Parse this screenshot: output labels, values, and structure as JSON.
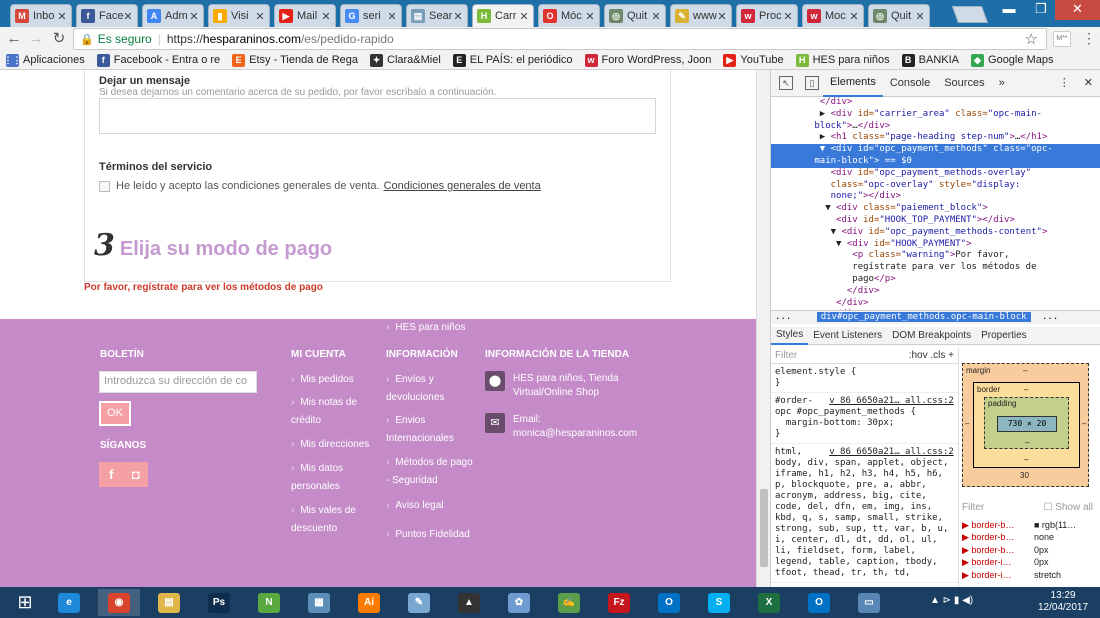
{
  "browser": {
    "tabs": [
      {
        "title": "Inbo",
        "icon": "gmail-icon",
        "color": "#d44638",
        "glyph": "M"
      },
      {
        "title": "Face",
        "icon": "facebook-icon",
        "color": "#3b5998",
        "glyph": "f"
      },
      {
        "title": "Adm",
        "icon": "adwords-icon",
        "color": "#4285f4",
        "glyph": "A"
      },
      {
        "title": "Visi",
        "icon": "analytics-icon",
        "color": "#f9ab00",
        "glyph": "▮"
      },
      {
        "title": "Mail",
        "icon": "youtube-icon",
        "color": "#e62117",
        "glyph": "▶"
      },
      {
        "title": "seri",
        "icon": "google-icon",
        "color": "#4a8af4",
        "glyph": "G"
      },
      {
        "title": "Sear",
        "icon": "search-console-icon",
        "color": "#7a9db8",
        "glyph": "▤"
      },
      {
        "title": "Carr",
        "icon": "hes-icon",
        "color": "#7cba3c",
        "glyph": "H"
      },
      {
        "title": "Móc",
        "icon": "opera-icon",
        "color": "#e2332d",
        "glyph": "O"
      },
      {
        "title": "Quit",
        "icon": "globe-icon",
        "color": "#6f8a6a",
        "glyph": "◎"
      },
      {
        "title": "www",
        "icon": "pencil-icon",
        "color": "#d9b233",
        "glyph": "✎"
      },
      {
        "title": "Proc",
        "icon": "wallapop-icon",
        "color": "#d0283a",
        "glyph": "w"
      },
      {
        "title": "Moc",
        "icon": "wallapop-icon",
        "color": "#d0283a",
        "glyph": "w"
      },
      {
        "title": "Quit",
        "icon": "globe-icon",
        "color": "#6f8a6a",
        "glyph": "◎"
      }
    ],
    "close_glyph": "✕",
    "secure_label": "Es seguro",
    "url_scheme": "https://",
    "url_host": "hesparaninos.com",
    "url_path": "/es/pedido-rapido",
    "extension_label": "M**"
  },
  "bookmarks": [
    {
      "label": "Aplicaciones",
      "icon": "apps-icon",
      "color": "#4a74c9",
      "glyph": "⋮⋮"
    },
    {
      "label": "Facebook - Entra o re",
      "icon": "facebook-icon",
      "color": "#3b5998",
      "glyph": "f"
    },
    {
      "label": "Etsy - Tienda de Rega",
      "icon": "etsy-icon",
      "color": "#f1641e",
      "glyph": "E"
    },
    {
      "label": "Clara&Miel",
      "icon": "butterfly-icon",
      "color": "#333333",
      "glyph": "✦"
    },
    {
      "label": "EL PAÍS: el periódico",
      "icon": "elpais-icon",
      "color": "#222222",
      "glyph": "E"
    },
    {
      "label": "Foro WordPress, Joon",
      "icon": "wallapop-icon",
      "color": "#d0283a",
      "glyph": "w"
    },
    {
      "label": "YouTube",
      "icon": "youtube-icon",
      "color": "#e62117",
      "glyph": "▶"
    },
    {
      "label": "HES para niños",
      "icon": "hes-icon",
      "color": "#7cba3c",
      "glyph": "H"
    },
    {
      "label": "BANKIA",
      "icon": "bankia-icon",
      "color": "#222222",
      "glyph": "B"
    },
    {
      "label": "Google Maps",
      "icon": "maps-icon",
      "color": "#34a853",
      "glyph": "◆"
    }
  ],
  "page": {
    "message_title": "Dejar un mensaje",
    "message_hint": "Si desea dejarnos un comentario acerca de su pedido, por favor escríbalo a continuación.",
    "terms_title": "Términos del servicio",
    "terms_text": "He leído y acepto las condiciones generales de venta.",
    "terms_link": "Condiciones generales de venta",
    "step_number": "3",
    "step_title": "Elija su modo de pago",
    "warning": "Por favor, regístrate para ver los métodos de pago"
  },
  "footer": {
    "newsletter_heading": "BOLETÍN",
    "newsletter_placeholder": "Introduzca su dirección de co",
    "ok_label": "OK",
    "follow_heading": "SÍGANOS",
    "facebook_glyph": "f",
    "instagram_glyph": "◘",
    "account_heading": "MI CUENTA",
    "account_links": [
      "Mis pedidos",
      "Mis notas de crédito",
      "Mis direcciones",
      "Mis datos personales",
      "Mis vales de descuento"
    ],
    "info_heading": "INFORMACIÓN",
    "info_links": [
      "Envíos y devoluciones",
      "Envios Internacionales",
      "Métodos de pago - Seguridad",
      "Aviso legal",
      "Puntos Fidelidad",
      "HES para niños"
    ],
    "store_heading": "INFORMACIÓN DE LA TIENDA",
    "store_name": "HES para niños, Tienda Virtual/Online Shop",
    "email_label": "Email:",
    "email": "monica@hesparaninos.com"
  },
  "devtools": {
    "tabs": [
      "Elements",
      "Console",
      "Sources",
      "»"
    ],
    "dom_lines": [
      {
        "indent": 9,
        "parts": [
          [
            "tag",
            "</div>"
          ]
        ]
      },
      {
        "indent": 9,
        "parts": [
          [
            "p",
            "▶ "
          ],
          [
            "tag",
            "<div "
          ],
          [
            "an",
            "id="
          ],
          [
            "av",
            "\"carrier_area\""
          ],
          [
            "an",
            " class="
          ],
          [
            "av",
            "\"opc-main-"
          ]
        ]
      },
      {
        "indent": 8,
        "parts": [
          [
            "av",
            "block\""
          ],
          [
            "tag",
            ">"
          ],
          [
            "p",
            "…"
          ],
          [
            "tag",
            "</div>"
          ]
        ]
      },
      {
        "indent": 9,
        "parts": [
          [
            "p",
            "▶ "
          ],
          [
            "tag",
            "<h1 "
          ],
          [
            "an",
            "class="
          ],
          [
            "av",
            "\"page-heading step-num\""
          ],
          [
            "tag",
            ">"
          ],
          [
            "p",
            "…"
          ],
          [
            "tag",
            "</h1>"
          ]
        ]
      },
      {
        "indent": 9,
        "sel": true,
        "parts": [
          [
            "p",
            "▼ "
          ],
          [
            "tag",
            "<div "
          ],
          [
            "an",
            "id="
          ],
          [
            "av",
            "\"opc_payment_methods\""
          ],
          [
            "an",
            " class="
          ],
          [
            "av",
            "\"opc-"
          ]
        ]
      },
      {
        "indent": 8,
        "sel": true,
        "parts": [
          [
            "av",
            "main-block\""
          ],
          [
            "tag",
            ">"
          ],
          [
            "p",
            " == $0"
          ]
        ]
      },
      {
        "indent": 11,
        "parts": [
          [
            "tag",
            "<div "
          ],
          [
            "an",
            "id="
          ],
          [
            "av",
            "\"opc_payment_methods-overlay\""
          ]
        ]
      },
      {
        "indent": 11,
        "parts": [
          [
            "an",
            "class="
          ],
          [
            "av",
            "\"opc-overlay\""
          ],
          [
            "an",
            " style="
          ],
          [
            "av",
            "\"display:"
          ]
        ]
      },
      {
        "indent": 11,
        "parts": [
          [
            "av",
            "none;\""
          ],
          [
            "tag",
            "></div>"
          ]
        ]
      },
      {
        "indent": 10,
        "parts": [
          [
            "p",
            "▼ "
          ],
          [
            "tag",
            "<div "
          ],
          [
            "an",
            "class="
          ],
          [
            "av",
            "\"paiement_block\""
          ],
          [
            "tag",
            ">"
          ]
        ]
      },
      {
        "indent": 12,
        "parts": [
          [
            "tag",
            "<div "
          ],
          [
            "an",
            "id="
          ],
          [
            "av",
            "\"HOOK_TOP_PAYMENT\""
          ],
          [
            "tag",
            "></div>"
          ]
        ]
      },
      {
        "indent": 11,
        "parts": [
          [
            "p",
            "▼ "
          ],
          [
            "tag",
            "<div "
          ],
          [
            "an",
            "id="
          ],
          [
            "av",
            "\"opc_payment_methods-content\""
          ],
          [
            "tag",
            ">"
          ]
        ]
      },
      {
        "indent": 12,
        "parts": [
          [
            "p",
            "▼ "
          ],
          [
            "tag",
            "<div "
          ],
          [
            "an",
            "id="
          ],
          [
            "av",
            "\"HOOK_PAYMENT\""
          ],
          [
            "tag",
            ">"
          ]
        ]
      },
      {
        "indent": 15,
        "parts": [
          [
            "tag",
            "<p "
          ],
          [
            "an",
            "class="
          ],
          [
            "av",
            "\"warning\""
          ],
          [
            "tag",
            ">"
          ],
          [
            "p",
            "Por favor,"
          ]
        ]
      },
      {
        "indent": 15,
        "parts": [
          [
            "p",
            "regístrate para ver los métodos de"
          ]
        ]
      },
      {
        "indent": 15,
        "parts": [
          [
            "p",
            "pago"
          ],
          [
            "tag",
            "</p>"
          ]
        ]
      },
      {
        "indent": 14,
        "parts": [
          [
            "tag",
            "</div>"
          ]
        ]
      },
      {
        "indent": 12,
        "parts": [
          [
            "tag",
            "</div>"
          ]
        ]
      },
      {
        "indent": 11,
        "parts": [
          [
            "tag",
            "</div>"
          ]
        ]
      }
    ],
    "breadcrumb_dots": "...",
    "breadcrumb": "div#opc_payment_methods.opc-main-block",
    "breadcrumb_more": "...",
    "style_tabs": [
      "Styles",
      "Event Listeners",
      "DOM Breakpoints",
      "Properties"
    ],
    "filter_placeholder": "Filter",
    "filter_hov": ":hov  .cls  +",
    "element_style": "element.style {\n}",
    "rule1_selector": "#order-",
    "rule1_source": "v_86_6650a21… all.css:2",
    "rule1_body": "opc #opc_payment_methods {\n  margin-bottom: 30px;\n}",
    "rule2_selector": "html,",
    "rule2_source": "v_86_6650a21… all.css:2",
    "rule2_body": "body, div, span, applet, object,\niframe, h1, h2, h3, h4, h5, h6,\np, blockquote, pre, a, abbr,\nacronym, address, big, cite,\ncode, del, dfn, em, img, ins,\nkbd, q, s, samp, small, strike,\nstrong, sub, sup, tt, var, b, u,\ni, center, dl, dt, dd, ol, ul,\nli, fieldset, form, label,\nlegend, table, caption, tbody,\ntfoot, thead, tr, th, td,",
    "box_margin_label": "margin",
    "box_border_label": "border",
    "box_padding_label": "padding",
    "box_dash": "–",
    "box_content": "730 × 20",
    "box_margin_bottom": "30",
    "computed_filter": "Filter",
    "computed_show_all": "Show all",
    "computed_rows": [
      {
        "k": "▶ border-b…",
        "v": "■ rgb(11…"
      },
      {
        "k": "▶ border-b…",
        "v": "none"
      },
      {
        "k": "▶ border-b…",
        "v": "0px"
      },
      {
        "k": "▶ border-i…",
        "v": "0px"
      },
      {
        "k": "▶ border-i…",
        "v": "stretch"
      }
    ]
  },
  "taskbar": {
    "items": [
      {
        "name": "ie-taskbar-icon",
        "glyph": "e",
        "color": "#1e88d8"
      },
      {
        "name": "chrome-taskbar-icon",
        "glyph": "◉",
        "color": "#d9442f",
        "active": true
      },
      {
        "name": "file-explorer-taskbar-icon",
        "glyph": "▤",
        "color": "#e0b64a"
      },
      {
        "name": "photoshop-taskbar-icon",
        "glyph": "Ps",
        "color": "#0f2e4d"
      },
      {
        "name": "notepadpp-taskbar-icon",
        "glyph": "N",
        "color": "#59a840"
      },
      {
        "name": "calculator-taskbar-icon",
        "glyph": "▦",
        "color": "#5b8fb8"
      },
      {
        "name": "illustrator-taskbar-icon",
        "glyph": "Ai",
        "color": "#ff7c00"
      },
      {
        "name": "notepad-taskbar-icon",
        "glyph": "✎",
        "color": "#7aa7cf"
      },
      {
        "name": "inkscape-taskbar-icon",
        "glyph": "▲",
        "color": "#333333"
      },
      {
        "name": "paint-taskbar-icon",
        "glyph": "✿",
        "color": "#6f9bd1"
      },
      {
        "name": "editor-taskbar-icon",
        "glyph": "✍",
        "color": "#5a9e4a"
      },
      {
        "name": "filezilla-taskbar-icon",
        "glyph": "Fz",
        "color": "#c4161c"
      },
      {
        "name": "outlook-taskbar-icon",
        "glyph": "O",
        "color": "#0072c6"
      },
      {
        "name": "skype-taskbar-icon",
        "glyph": "S",
        "color": "#00aff0"
      },
      {
        "name": "excel-taskbar-icon",
        "glyph": "X",
        "color": "#1d6f42"
      },
      {
        "name": "outlook2-taskbar-icon",
        "glyph": "O",
        "color": "#0072c6"
      },
      {
        "name": "monitor-taskbar-icon",
        "glyph": "▭",
        "color": "#5a86b5"
      }
    ],
    "tray": "▲  ⊳ ▮ ◀)",
    "time": "13:29",
    "date": "12/04/2017"
  }
}
